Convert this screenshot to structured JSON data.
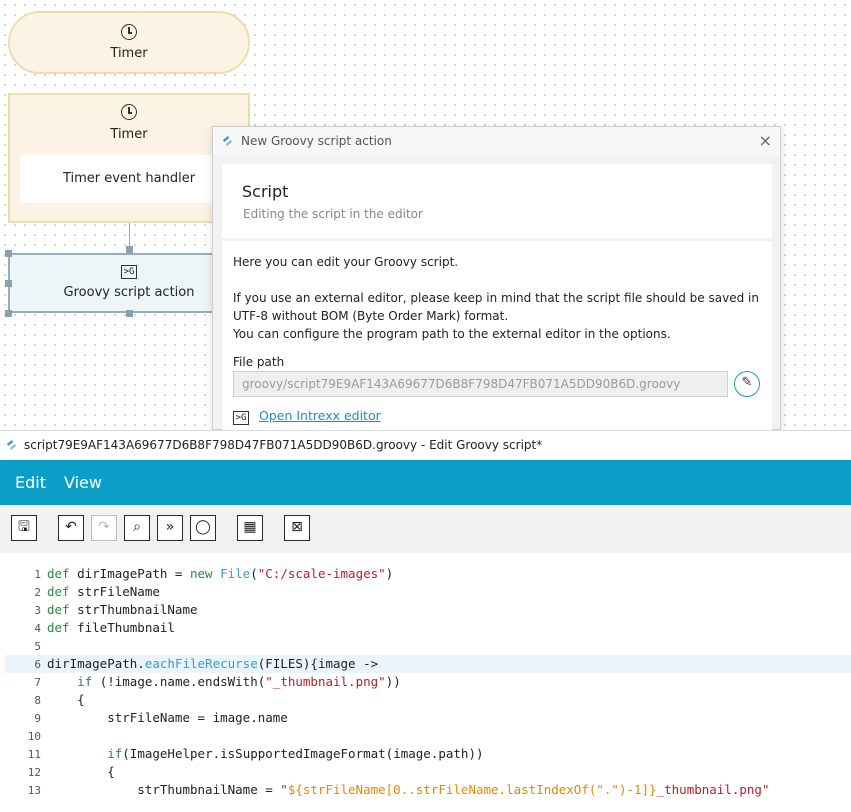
{
  "workflow": {
    "timer_start_label": "Timer",
    "timer_label": "Timer",
    "timer_handler_label": "Timer event handler",
    "groovy_node_label": "Groovy script action"
  },
  "dialog": {
    "title": "New Groovy script action",
    "close": "×",
    "heading": "Script",
    "subheading": "Editing the script in the editor",
    "intro": "Here you can edit your Groovy script.",
    "info_line1": "If you use an external editor, please keep in mind that the script file should be saved in",
    "info_line2": "UTF-8 without BOM (Byte Order Mark) format.",
    "info_line3": "You can configure the program path to the external editor in the options.",
    "file_path_label": "File path",
    "file_path_value": "groovy/script79E9AF143A69677D6B8F798D47FB071A5DD90B6D.groovy",
    "open_editor_link": "Open Intrexx editor"
  },
  "editor": {
    "title": "script79E9AF143A69677D6B8F798D47FB071A5DD90B6D.groovy - Edit Groovy script*",
    "menu": [
      "Edit",
      "View"
    ],
    "toolbar": [
      {
        "icon": "save-icon",
        "glyph": "🖫",
        "enabled": true
      },
      {
        "icon": "undo-icon",
        "glyph": "↶",
        "enabled": true
      },
      {
        "icon": "redo-icon",
        "glyph": "↷",
        "enabled": false
      },
      {
        "icon": "search-icon",
        "glyph": "⌕",
        "enabled": true
      },
      {
        "icon": "goto-icon",
        "glyph": "»",
        "enabled": true
      },
      {
        "icon": "comment-icon",
        "glyph": "◯",
        "enabled": true
      },
      {
        "icon": "script-test-icon",
        "glyph": "▦",
        "enabled": true
      },
      {
        "icon": "close-script-icon",
        "glyph": "⊠",
        "enabled": true
      }
    ],
    "code": [
      {
        "n": "1",
        "hl": false,
        "parts": [
          [
            "kw",
            "def"
          ],
          [
            "txt",
            " dirImagePath = "
          ],
          [
            "kw",
            "new"
          ],
          [
            "txt",
            " "
          ],
          [
            "fn",
            "File"
          ],
          [
            "txt",
            "("
          ],
          [
            "str",
            "\"C:/scale-images\""
          ],
          [
            "txt",
            ")"
          ]
        ]
      },
      {
        "n": "2",
        "hl": false,
        "parts": [
          [
            "kw",
            "def"
          ],
          [
            "txt",
            " strFileName"
          ]
        ]
      },
      {
        "n": "3",
        "hl": false,
        "parts": [
          [
            "kw",
            "def"
          ],
          [
            "txt",
            " strThumbnailName"
          ]
        ]
      },
      {
        "n": "4",
        "hl": false,
        "parts": [
          [
            "kw",
            "def"
          ],
          [
            "txt",
            " fileThumbnail"
          ]
        ]
      },
      {
        "n": "5",
        "hl": false,
        "parts": []
      },
      {
        "n": "6",
        "hl": true,
        "parts": [
          [
            "txt",
            "dirImagePath."
          ],
          [
            "fn",
            "eachFileRecurse"
          ],
          [
            "txt",
            "(FILES){image ->"
          ]
        ]
      },
      {
        "n": "7",
        "hl": false,
        "parts": [
          [
            "txt",
            "    "
          ],
          [
            "kw",
            "if"
          ],
          [
            "txt",
            " (!image.name.endsWith("
          ],
          [
            "str",
            "\"_thumbnail.png\""
          ],
          [
            "txt",
            "))"
          ]
        ]
      },
      {
        "n": "8",
        "hl": false,
        "parts": [
          [
            "txt",
            "    {"
          ]
        ]
      },
      {
        "n": "9",
        "hl": false,
        "parts": [
          [
            "txt",
            "        strFileName = image.name"
          ]
        ]
      },
      {
        "n": "10",
        "hl": false,
        "parts": []
      },
      {
        "n": "11",
        "hl": false,
        "parts": [
          [
            "txt",
            "        "
          ],
          [
            "kw",
            "if"
          ],
          [
            "txt",
            "(ImageHelper.isSupportedImageFormat(image.path))"
          ]
        ]
      },
      {
        "n": "12",
        "hl": false,
        "parts": [
          [
            "txt",
            "        {"
          ]
        ]
      },
      {
        "n": "13",
        "hl": false,
        "parts": [
          [
            "txt",
            "            strThumbnailName = "
          ],
          [
            "str",
            "\""
          ],
          [
            "str2",
            "${strFileName[0..strFileName.lastIndexOf(\".\")-1]}"
          ],
          [
            "str",
            "_thumbnail.png\""
          ]
        ]
      }
    ]
  }
}
